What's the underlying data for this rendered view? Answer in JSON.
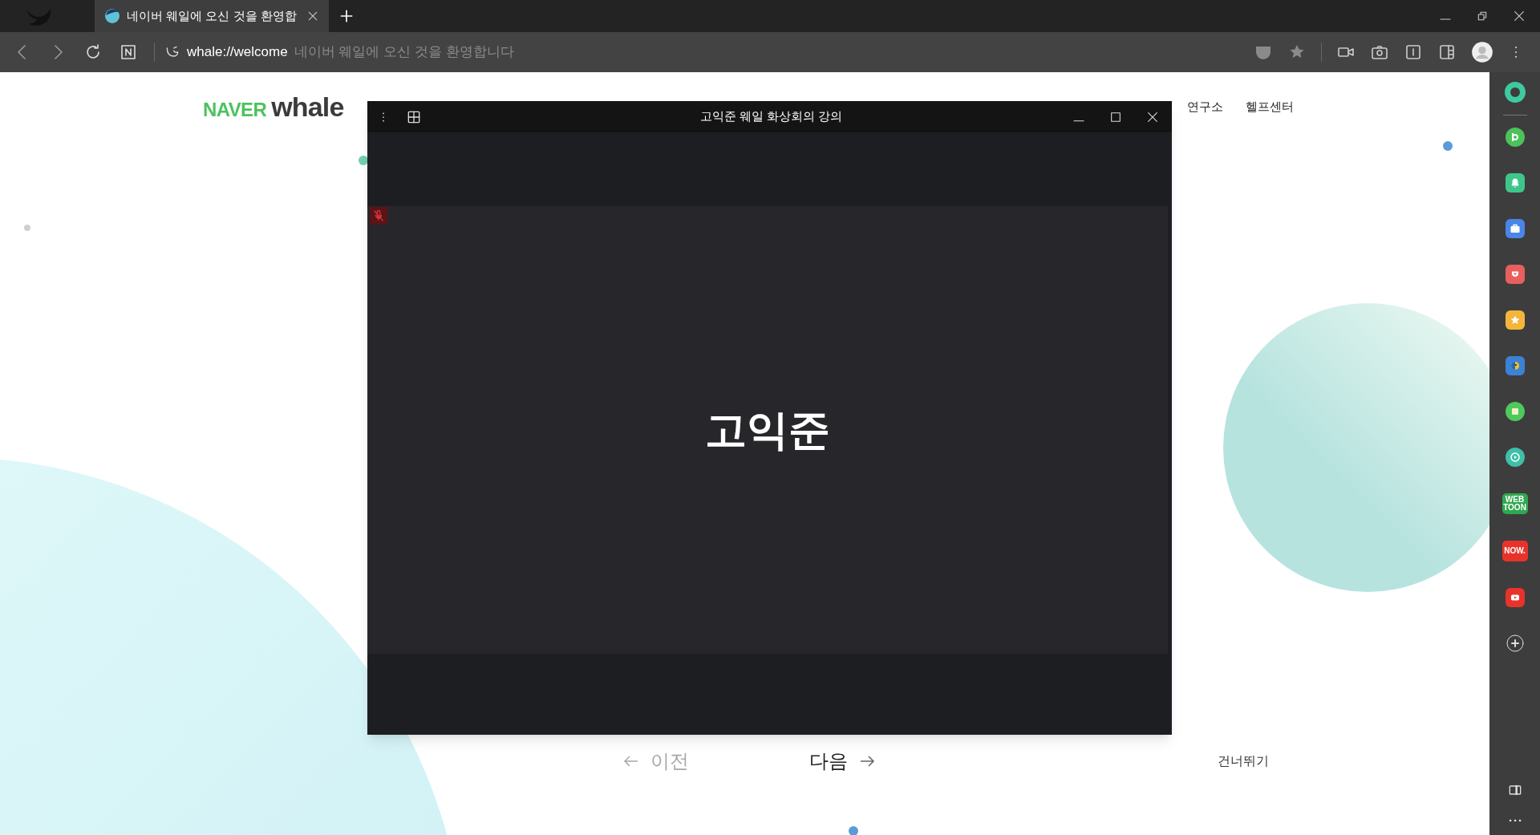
{
  "browser": {
    "tabs": [
      {
        "title": "네이버 웨일에 오신 것을 환영합",
        "selected": true
      }
    ],
    "address": {
      "url": "whale://welcome",
      "page_title": "네이버 웨일에 오신 것을 환영합니다"
    }
  },
  "page": {
    "logo": {
      "brand": "NAVER",
      "product": "whale"
    },
    "nav_links": [
      "연구소",
      "헬프센터"
    ],
    "prev_button": {
      "label": "이전",
      "disabled": true
    },
    "next_button": {
      "label": "다음",
      "disabled": false
    },
    "skip_link": "건너뛰기"
  },
  "meeting_window": {
    "title": "고익준 웨일 화상회의 강의",
    "participant": {
      "name": "고익준",
      "muted": true
    }
  },
  "sidebar": {
    "apps": [
      {
        "kind": "b",
        "color": "#4cc25a"
      },
      {
        "kind": "bell",
        "color": "#3ec68a"
      },
      {
        "kind": "briefcase",
        "color": "#4a86e8"
      },
      {
        "kind": "pocket",
        "color": "#e8605d"
      },
      {
        "kind": "star",
        "color": "#f4b53a"
      },
      {
        "kind": "bird",
        "color": "#3b82d6"
      },
      {
        "kind": "grid",
        "color": "#4ec95c"
      },
      {
        "kind": "play",
        "color": "#3fbfa8"
      },
      {
        "kind": "text",
        "color": "#2fa84f",
        "lines": [
          "WEB",
          "TOON"
        ]
      },
      {
        "kind": "text",
        "color": "#e8332a",
        "lines": [
          "NOW."
        ]
      },
      {
        "kind": "youtube",
        "color": "#e8332a"
      }
    ]
  }
}
